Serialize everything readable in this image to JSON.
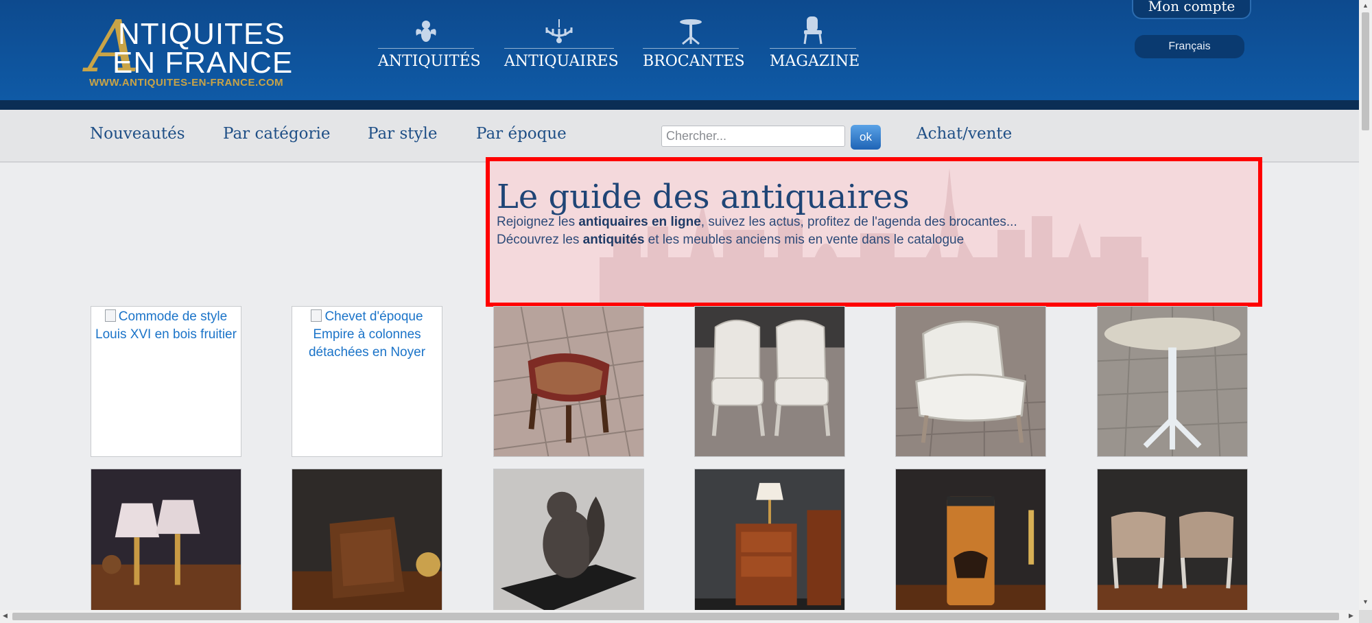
{
  "logo": {
    "line1": "NTIQUITES",
    "big_letter": "A",
    "line2": "EN FRANCE",
    "url": "WWW.ANTIQUITES-EN-FRANCE.COM",
    "gold": "#c9a447"
  },
  "topnav": [
    {
      "label": "ANTIQUITÉS",
      "icon": "cherub-icon"
    },
    {
      "label": "ANTIQUAIRES",
      "icon": "chandelier-icon"
    },
    {
      "label": "BROCANTES",
      "icon": "pedestal-table-icon"
    },
    {
      "label": "MAGAZINE",
      "icon": "chair-icon"
    }
  ],
  "account": {
    "label": "Mon compte"
  },
  "language": {
    "label": "Français"
  },
  "subnav": {
    "links": [
      "Nouveautés",
      "Par catégorie",
      "Par style",
      "Par époque"
    ],
    "search_placeholder": "Chercher...",
    "search_button": "ok",
    "extra_link": "Achat/vente"
  },
  "guide": {
    "title": "Le guide des antiquaires",
    "line1_pre": "Rejoignez les ",
    "line1_bold": "antiquaires en ligne",
    "line1_post": ", suivez les actus, profitez de l'agenda des brocantes...",
    "line2_pre": "Découvrez les ",
    "line2_bold": "antiquités",
    "line2_post": " et les meubles anciens mis en vente dans le catalogue"
  },
  "grid": {
    "row1": [
      {
        "alt": "Commode de style Louis XVI en bois fruitier",
        "broken": true
      },
      {
        "alt": "Chevet d'époque Empire à colonnes détachées en Noyer",
        "broken": true
      },
      {
        "alt": "",
        "scene": "stool-on-tiles"
      },
      {
        "alt": "",
        "scene": "pair-armchairs"
      },
      {
        "alt": "",
        "scene": "armchair"
      },
      {
        "alt": "",
        "scene": "marble-table"
      }
    ],
    "row2": [
      {
        "alt": "",
        "scene": "pair-lamps"
      },
      {
        "alt": "",
        "scene": "wooden-box"
      },
      {
        "alt": "",
        "scene": "bronze-squirrel"
      },
      {
        "alt": "",
        "scene": "nightstand"
      },
      {
        "alt": "",
        "scene": "vase"
      },
      {
        "alt": "",
        "scene": "pair-stools"
      }
    ]
  },
  "colors": {
    "header_blue": "#0f5aa6",
    "link_blue": "#1f4f86",
    "highlight_red": "#ff0000",
    "highlight_fill": "#f4d9dc"
  }
}
